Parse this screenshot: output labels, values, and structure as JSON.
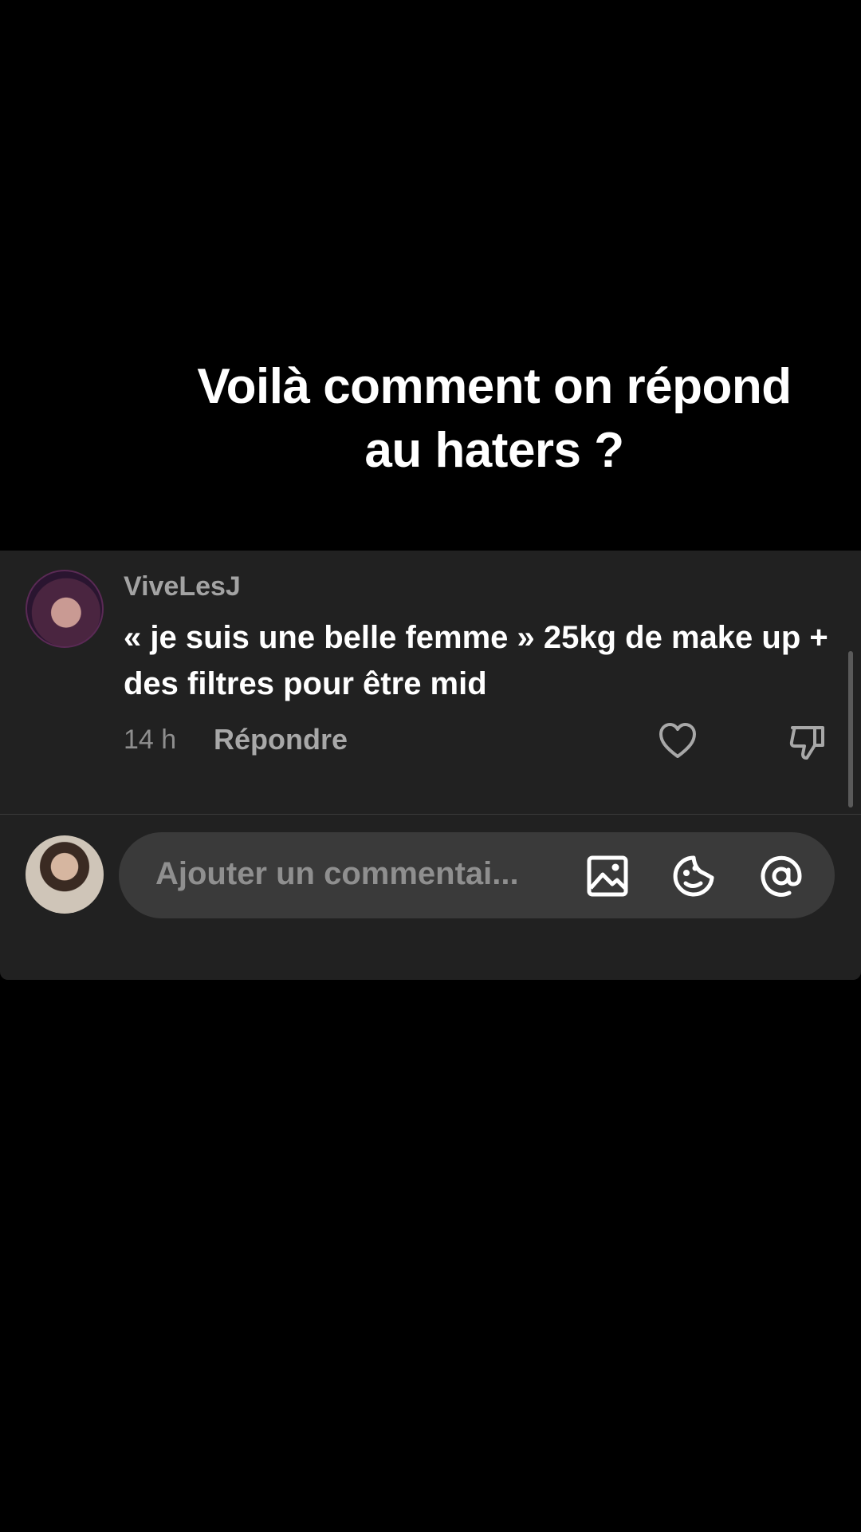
{
  "caption": {
    "line1": "Voilà comment on répond",
    "line2": "au haters ?"
  },
  "comment": {
    "username": "ViveLesJ",
    "text": "« je suis une belle femme » 25kg de make up + des filtres pour être mid",
    "time": "14 h",
    "reply_label": "Répondre"
  },
  "composer": {
    "placeholder": "Ajouter un commentai..."
  },
  "icons": {
    "like": "heart-icon",
    "dislike": "thumbs-down-icon",
    "image": "image-icon",
    "emoji": "emoji-icon",
    "mention": "at-icon"
  },
  "colors": {
    "background": "#000000",
    "panel": "#212121",
    "input_bg": "#3a3a3a",
    "muted_text": "#a3a3a3"
  }
}
